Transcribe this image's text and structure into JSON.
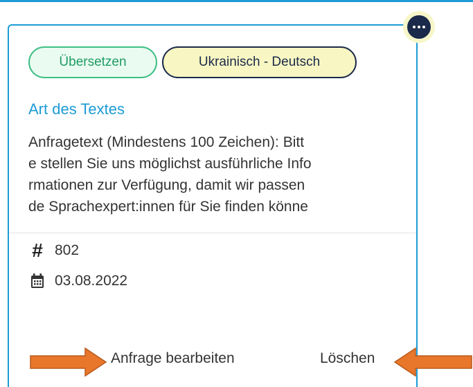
{
  "card": {
    "more_menu_icon": "more-horizontal-icon",
    "tags": [
      "Übersetzen",
      "Ukrainisch - Deutsch"
    ],
    "title": "Art des Textes",
    "description_lines": [
      "Anfragetext (Mindestens 100 Zeichen): Bitt",
      "e stellen Sie uns möglichst ausführliche Info",
      "rmationen zur Verfügung, damit wir passen",
      "de Sprachexpert:innen für Sie finden könne"
    ],
    "id_icon": "hash-icon",
    "id_value": "802",
    "date_icon": "calendar-icon",
    "date_value": "03.08.2022",
    "edit_label": "Anfrage bearbeiten",
    "delete_label": "Löschen"
  },
  "annotations": {
    "arrow_color": "#e8762b",
    "accent_color": "#1c9bd6"
  }
}
